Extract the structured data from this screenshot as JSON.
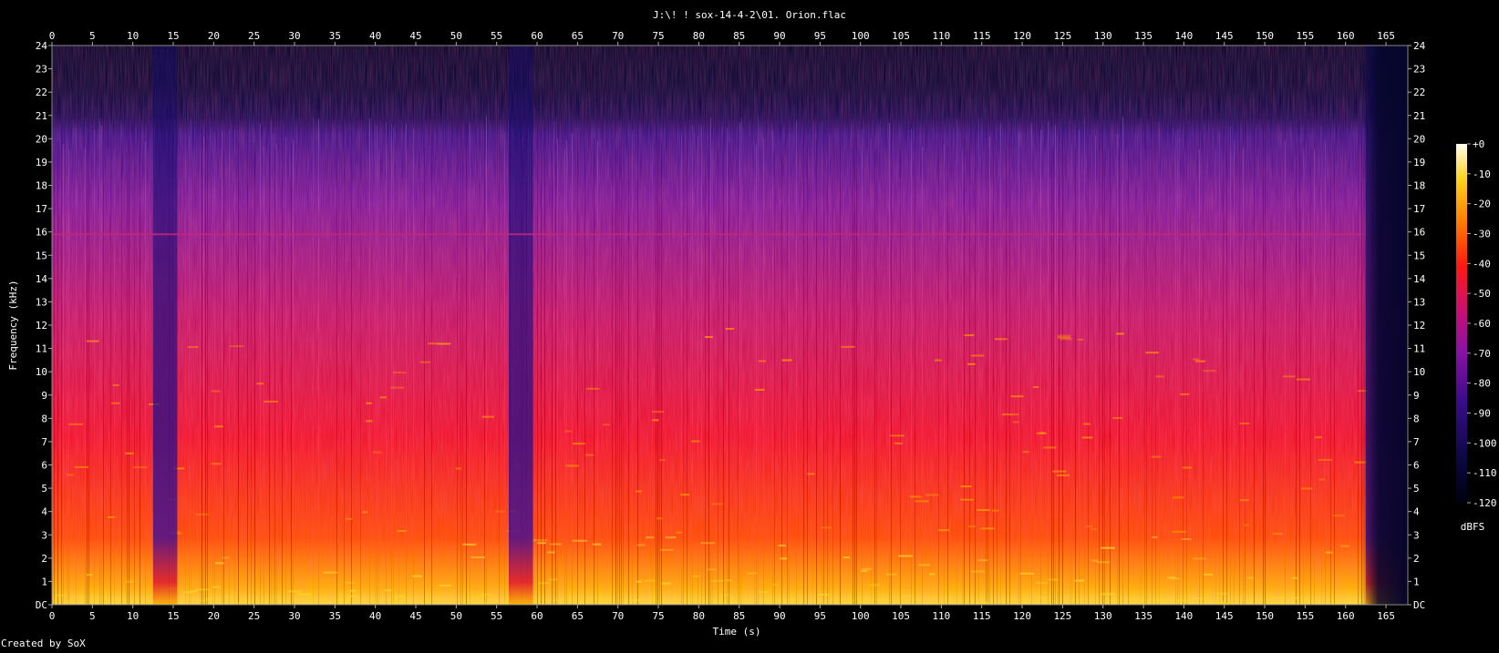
{
  "title": "J:\\! ! sox-14-4-2\\01. Orion.flac",
  "footer": "Created by SoX",
  "colors": {
    "background": "#000000",
    "text": "#ffffff",
    "axis": "#a0a0a0"
  },
  "chart_data": {
    "type": "heatmap",
    "title": "J:\\! ! sox-14-4-2\\01. Orion.flac",
    "xlabel": "Time (s)",
    "ylabel": "Frequency (kHz)",
    "xlim": [
      0,
      167.7
    ],
    "ylim": [
      0,
      24
    ],
    "x_ticks": [
      0,
      5,
      10,
      15,
      20,
      25,
      30,
      35,
      40,
      45,
      50,
      55,
      60,
      65,
      70,
      75,
      80,
      85,
      90,
      95,
      100,
      105,
      110,
      115,
      120,
      125,
      130,
      135,
      140,
      145,
      150,
      155,
      160,
      165
    ],
    "y_ticks": [
      "DC",
      "1",
      "2",
      "3",
      "4",
      "5",
      "6",
      "7",
      "8",
      "9",
      "10",
      "11",
      "12",
      "13",
      "14",
      "15",
      "16",
      "17",
      "18",
      "19",
      "20",
      "21",
      "22",
      "23",
      "24"
    ],
    "colorbar": {
      "label": "dBFS",
      "ticks": [
        "+0",
        "-10",
        "-20",
        "-30",
        "-40",
        "-50",
        "-60",
        "-70",
        "-80",
        "-90",
        "-100",
        "-110",
        "-120"
      ],
      "range": [
        -120,
        0
      ]
    },
    "features": {
      "lowpass_cutoff_khz": 21,
      "tone_line_khz": 15.9,
      "quiet_gaps_s": [
        [
          12.5,
          15.5
        ],
        [
          56.5,
          59.5
        ],
        [
          162.5,
          167.7
        ]
      ]
    }
  }
}
